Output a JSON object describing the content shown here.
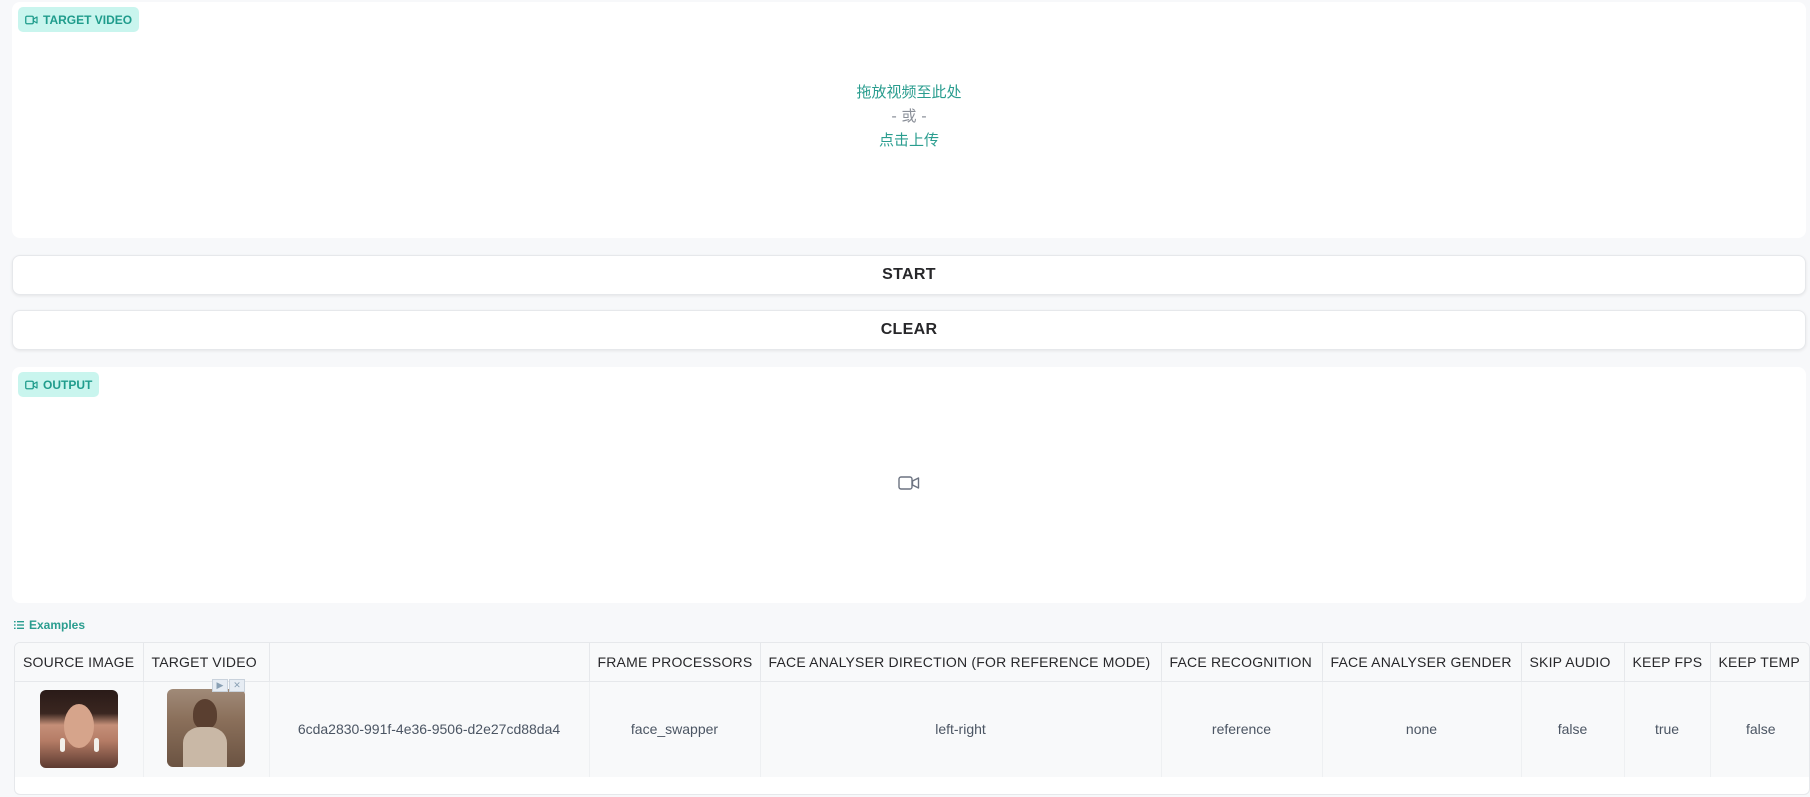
{
  "target_video": {
    "badge_label": "TARGET VIDEO",
    "drop_text": "拖放视频至此处",
    "or_text": "- 或 -",
    "click_text": "点击上传"
  },
  "buttons": {
    "start_label": "START",
    "clear_label": "CLEAR"
  },
  "output": {
    "badge_label": "OUTPUT"
  },
  "examples": {
    "label": "Examples",
    "columns": [
      "SOURCE IMAGE",
      "TARGET VIDEO",
      "",
      "FRAME PROCESSORS",
      "FACE ANALYSER DIRECTION (FOR REFERENCE MODE)",
      "FACE RECOGNITION",
      "FACE ANALYSER GENDER",
      "SKIP AUDIO",
      "KEEP FPS",
      "KEEP TEMP"
    ],
    "rows": [
      {
        "id": "6cda2830-991f-4e36-9506-d2e27cd88da4",
        "frame_processors": "face_swapper",
        "face_analyser_direction": "left-right",
        "face_recognition": "reference",
        "face_analyser_gender": "none",
        "skip_audio": "false",
        "keep_fps": "true",
        "keep_temp": "false"
      }
    ]
  },
  "colors": {
    "accent": "#2a9d8f",
    "badge_bg": "#c9f5ee",
    "page_bg": "#f7f8fa"
  }
}
